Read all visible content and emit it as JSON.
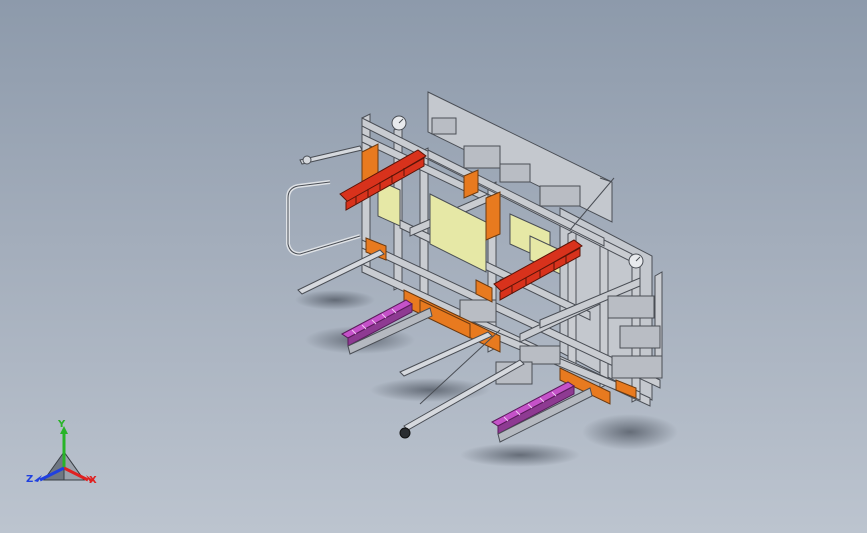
{
  "view": {
    "background_top": "#8d9aab",
    "background_bottom": "#bcc4cf",
    "model_name": "machine-assembly"
  },
  "colors": {
    "frame": "#c9ccd1",
    "frame_edge": "#4a4e55",
    "orange": "#e87a1f",
    "red": "#d8321c",
    "pale_yellow": "#e6e8a6",
    "magenta": "#c552c9",
    "shadow": "#5d6470"
  },
  "triad": {
    "x_label": "X",
    "y_label": "Y",
    "z_label": "Z",
    "x_color": "#e02020",
    "y_color": "#28b428",
    "z_color": "#2040e0",
    "icon": "coordinate-triad-icon"
  }
}
